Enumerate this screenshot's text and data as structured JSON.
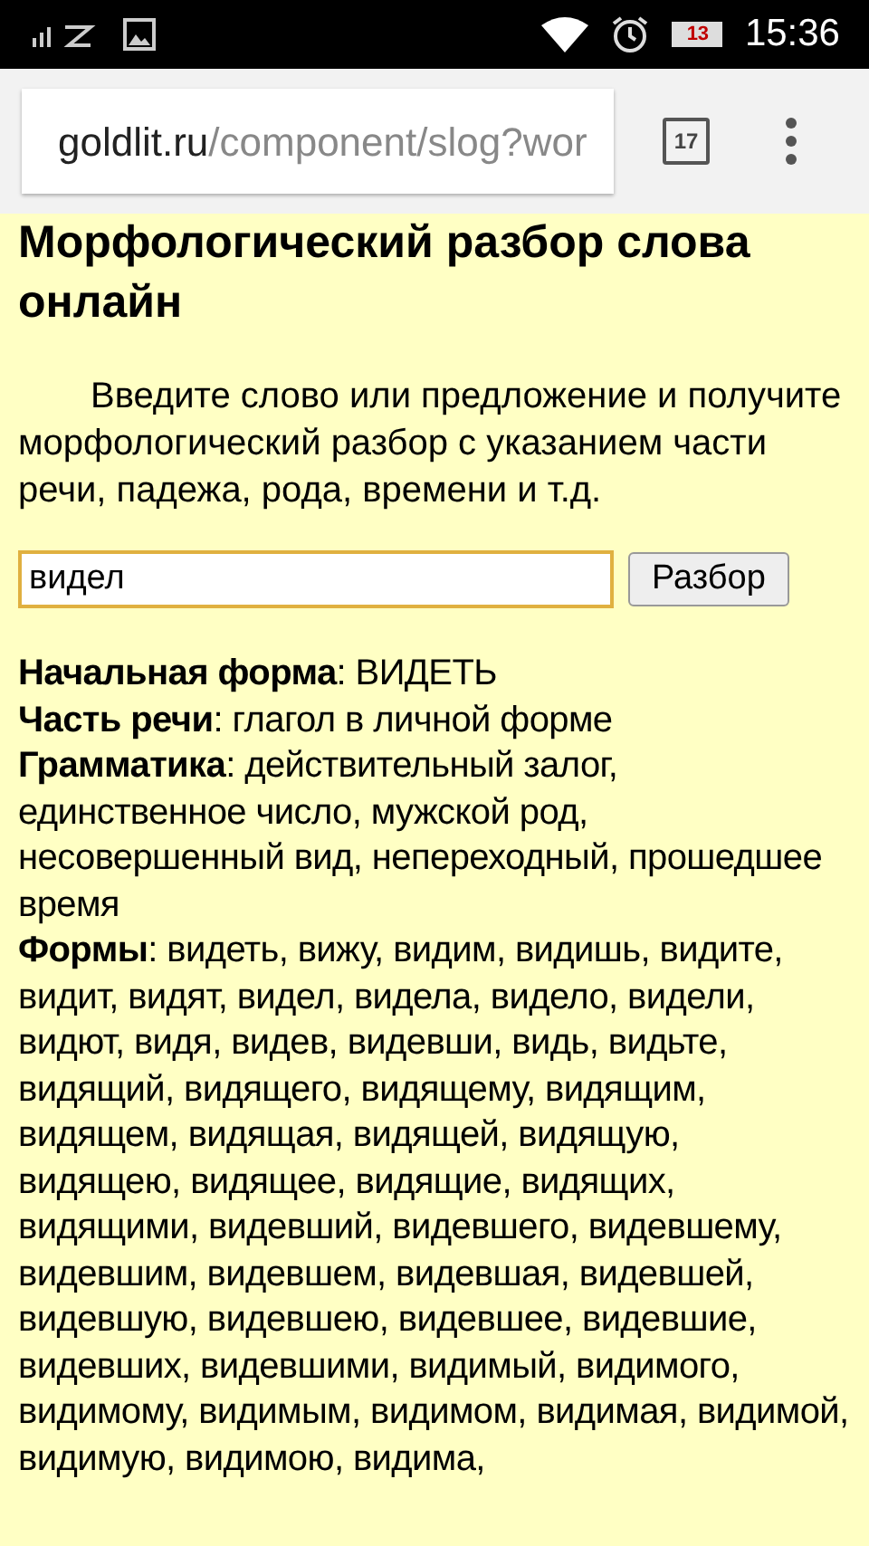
{
  "status_bar": {
    "time": "15:36",
    "battery": "13"
  },
  "browser": {
    "url_host": "goldlit.ru",
    "url_path": "/component/slog?wor",
    "tab_count": "17"
  },
  "page": {
    "title": "Морфологический разбор слова онлайн",
    "intro": "Введите слово или предложение и получите морфологический разбор с указанием части речи, падежа, рода, времени и т.д.",
    "search": {
      "value": "видел",
      "button": "Разбор"
    },
    "results": [
      "**Начальная форма**: ВИДЕТЬ",
      "**Часть речи**: глагол в личной форме",
      "**Грамматика**: действительный залог, единственное число, мужской род, несовершенный вид, непереходный, прошедшее время",
      "**Формы**: видеть, вижу, видим, видишь, видите, видит, видят, видел, видела, видело, видели, видют, видя, видев, видевши, видь, видьте, видящий, видящего, видящему, видящим, видящем, видящая, видящей, видящую, видящею, видящее, видящие, видящих, видящими, видевший, видевшего, видевшему, видевшим, видевшем, видевшая, видевшей, видевшую, видевшею, видевшее, видевшие, видевших, видевшими, видимый, видимого, видимому, видимым, видимом, видимая, видимой, видимую, видимою, видима,"
    ]
  }
}
